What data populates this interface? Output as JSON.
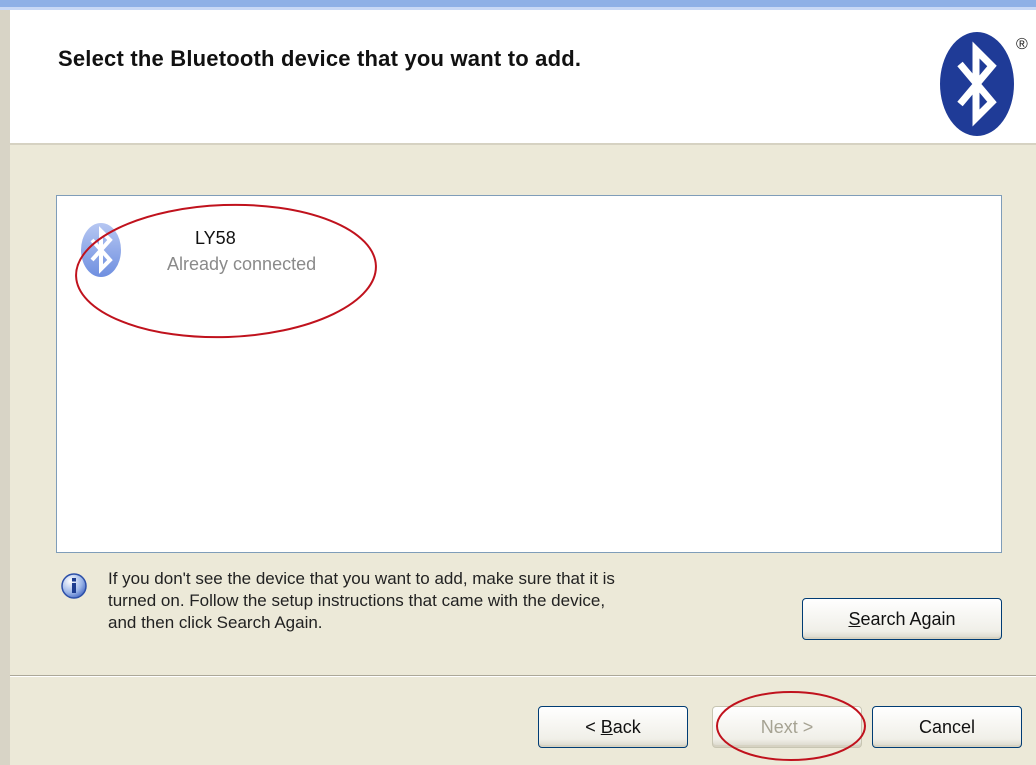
{
  "header": {
    "title": "Select the Bluetooth device that you want to add.",
    "logo_icon": "bluetooth-logo-icon",
    "registered_mark": "®"
  },
  "devices": [
    {
      "name": "LY58",
      "status": "Already connected",
      "icon": "bluetooth-device-icon"
    }
  ],
  "info": {
    "icon": "info-icon",
    "lines": [
      "If you don't see the device that you want to add, make sure that it is",
      "turned on. Follow the setup instructions that came with the device,",
      "and then click Search Again."
    ]
  },
  "buttons": {
    "search_again": {
      "prefix": "",
      "accel": "S",
      "rest": "earch Again"
    },
    "back": {
      "prefix": "< ",
      "accel": "B",
      "rest": "ack"
    },
    "next": {
      "label": "Next >"
    },
    "cancel": {
      "label": "Cancel"
    }
  },
  "colors": {
    "window_bg": "#ece9d8",
    "bluetooth_blue": "#1f3b97",
    "annotation_red": "#c0121d"
  }
}
